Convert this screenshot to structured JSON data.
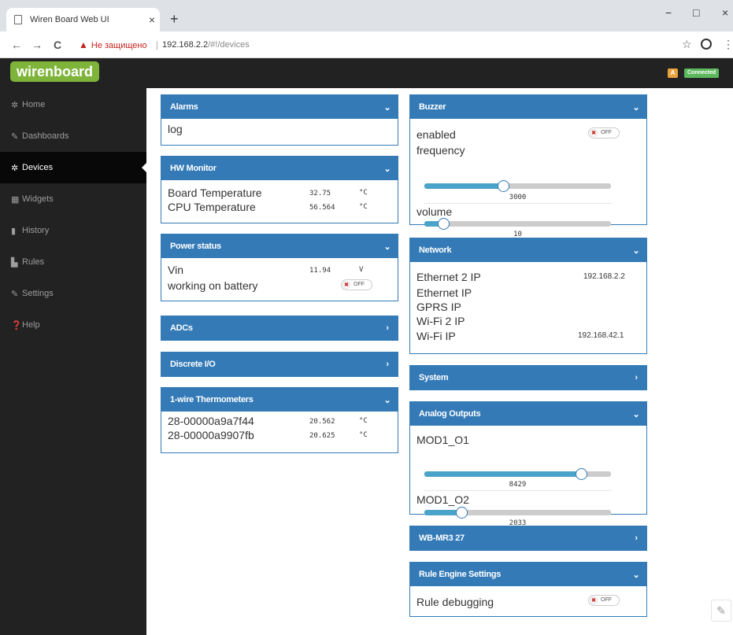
{
  "browser": {
    "tab_title": "Wiren Board Web UI",
    "tab_close": "×",
    "new_tab": "+",
    "win_min": "−",
    "win_max": "□",
    "win_close": "×",
    "back": "←",
    "forward": "→",
    "reload": "C",
    "warning_text": "Не защищено",
    "url_host": "192.168.2.2",
    "url_path": "/#!/devices",
    "star": "☆",
    "menu": "⋮"
  },
  "header": {
    "logo": "wirenboard",
    "indicator_a": "A",
    "status": "Connected"
  },
  "sidebar": {
    "items": [
      {
        "label": "Home",
        "icon": "gear-icon",
        "glyph": "✲"
      },
      {
        "label": "Dashboards",
        "icon": "wrench-icon",
        "glyph": "✎"
      },
      {
        "label": "Devices",
        "icon": "gear-icon",
        "glyph": "✲"
      },
      {
        "label": "Widgets",
        "icon": "grid-icon",
        "glyph": "▦"
      },
      {
        "label": "History",
        "icon": "bar-chart-icon",
        "glyph": "▮"
      },
      {
        "label": "Rules",
        "icon": "file-icon",
        "glyph": "▙"
      },
      {
        "label": "Settings",
        "icon": "wrench-icon",
        "glyph": "✎"
      },
      {
        "label": "Help",
        "icon": "question-icon",
        "glyph": "❓"
      }
    ],
    "active": "Devices"
  },
  "panels": {
    "alarms": {
      "title": "Alarms",
      "row": "log"
    },
    "hw_monitor": {
      "title": "HW Monitor",
      "rows": [
        {
          "label": "Board Temperature",
          "value": "32.75",
          "unit": "°C"
        },
        {
          "label": "CPU Temperature",
          "value": "56.564",
          "unit": "°C"
        }
      ]
    },
    "power_status": {
      "title": "Power status",
      "vin_label": "Vin",
      "vin_value": "11.94",
      "vin_unit": "V",
      "battery_label": "working on battery",
      "battery_state": "OFF"
    },
    "adcs": {
      "title": "ADCs"
    },
    "discrete_io": {
      "title": "Discrete I/O"
    },
    "thermometers": {
      "title": "1-wire Thermometers",
      "rows": [
        {
          "label": "28-00000a9a7f44",
          "value": "20.562",
          "unit": "°C"
        },
        {
          "label": "28-00000a9907fb",
          "value": "20.625",
          "unit": "°C"
        }
      ]
    },
    "buzzer": {
      "title": "Buzzer",
      "enabled_label": "enabled",
      "enabled_state": "OFF",
      "frequency_label": "frequency",
      "frequency_value": "3000",
      "frequency_fraction": 0.42,
      "volume_label": "volume",
      "volume_value": "10",
      "volume_fraction": 0.1
    },
    "network": {
      "title": "Network",
      "rows": [
        {
          "label": "Ethernet 2 IP",
          "value": "192.168.2.2"
        },
        {
          "label": "Ethernet IP",
          "value": ""
        },
        {
          "label": "GPRS IP",
          "value": ""
        },
        {
          "label": "Wi-Fi 2 IP",
          "value": ""
        },
        {
          "label": "Wi-Fi IP",
          "value": "192.168.42.1"
        }
      ]
    },
    "system": {
      "title": "System"
    },
    "analog_outputs": {
      "title": "Analog Outputs",
      "o1_label": "MOD1_O1",
      "o1_value": "8429",
      "o1_fraction": 0.84,
      "o2_label": "MOD1_O2",
      "o2_value": "2033",
      "o2_fraction": 0.2
    },
    "wb_mr3": {
      "title": "WB-MR3 27"
    },
    "rule_engine": {
      "title": "Rule Engine Settings",
      "debug_label": "Rule debugging",
      "debug_state": "OFF"
    }
  },
  "chevrons": {
    "down": "⌄",
    "right": "›"
  },
  "toggle_x": "✖"
}
